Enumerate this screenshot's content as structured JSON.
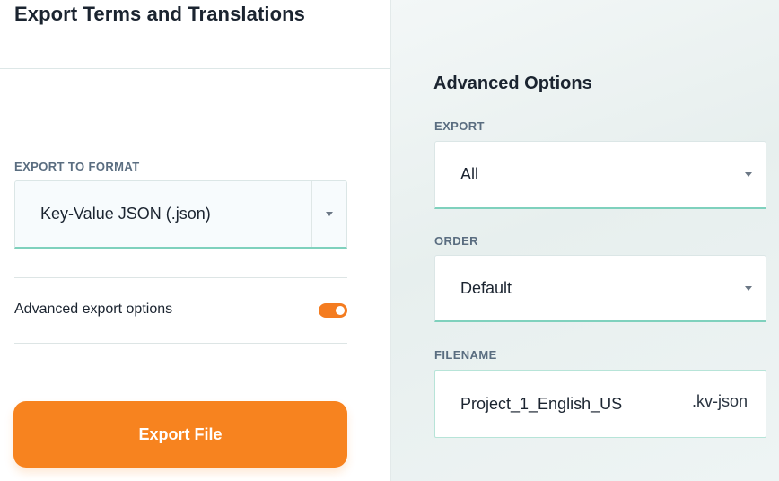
{
  "header": {
    "title": "Export Terms and Translations"
  },
  "left": {
    "format_label": "EXPORT TO FORMAT",
    "format_value": "Key-Value JSON (.json)",
    "advanced_toggle_label": "Advanced export options",
    "advanced_toggle_on": true,
    "export_button_label": "Export File"
  },
  "advanced": {
    "title": "Advanced Options",
    "export_label": "EXPORT",
    "export_value": "All",
    "order_label": "ORDER",
    "order_value": "Default",
    "filename_label": "FILENAME",
    "filename_value": "Project_1_English_US",
    "filename_extension": ".kv-json"
  },
  "icons": {
    "dropdown": "chevron-down-icon"
  },
  "colors": {
    "accent": "#f7831f",
    "field_underline": "#7fd1bd"
  }
}
